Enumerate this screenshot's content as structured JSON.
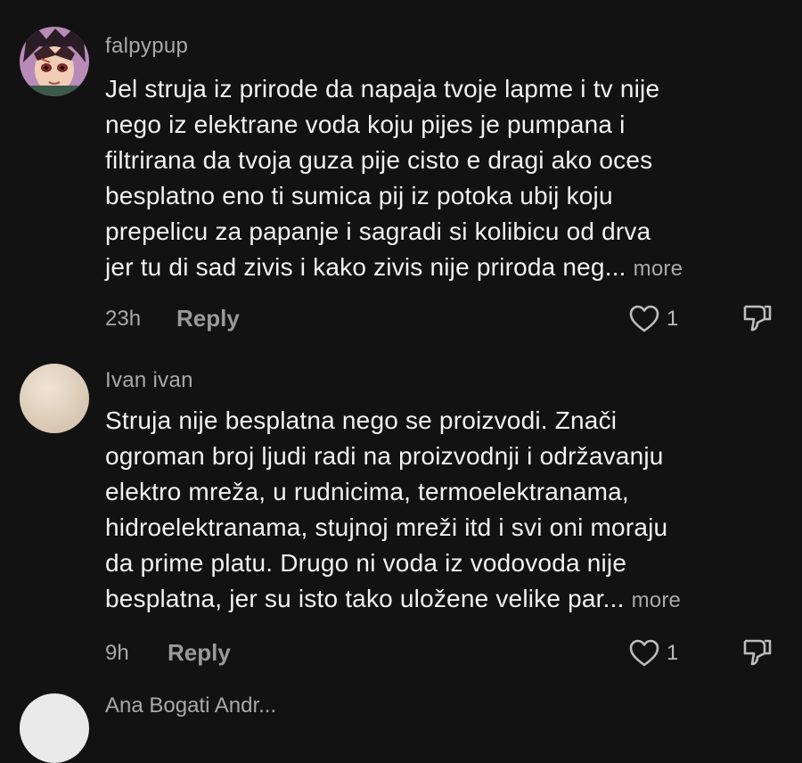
{
  "comments": [
    {
      "username": "falpypup",
      "avatar": "anime-character-avatar",
      "lines": [
        "Jel struja iz prirode da napaja tvoje lapme i tv nije",
        "nego iz elektrane voda koju pijes je pumpana i",
        "filtrirana da tvoja guza pije cisto e dragi ako oces",
        "besplatno eno ti sumica pij iz potoka ubij koju",
        "prepelicu za papanje i sagradi si kolibicu od drva",
        "jer tu di sad zivis i kako zivis nije priroda neg"
      ],
      "ellipsis": "...",
      "more_label": "more",
      "time": "23h",
      "reply_label": "Reply",
      "likes": "1",
      "avatar_color": "#4a3a3a"
    },
    {
      "username": "Ivan ivan",
      "avatar": "blank-avatar",
      "lines": [
        "Struja nije besplatna nego se proizvodi. Znači",
        "ogroman broj ljudi radi na proizvodnji i održavanju",
        "elektro mreža, u rudnicima, termoelektranama,",
        "hidroelektranama, stujnoj mreži itd i svi oni moraju",
        "da prime platu. Drugo ni voda iz vodovoda nije",
        "besplatna, jer su isto tako uložene velike par"
      ],
      "ellipsis": "...",
      "more_label": "more",
      "time": "9h",
      "reply_label": "Reply",
      "likes": "1",
      "avatar_color": "#e3d6c4"
    }
  ],
  "next_comment": {
    "username": "Ana Bogati Andr..."
  },
  "colors": {
    "background": "#121212",
    "text": "#f2f2f2",
    "secondary": "#a9a9a9"
  }
}
